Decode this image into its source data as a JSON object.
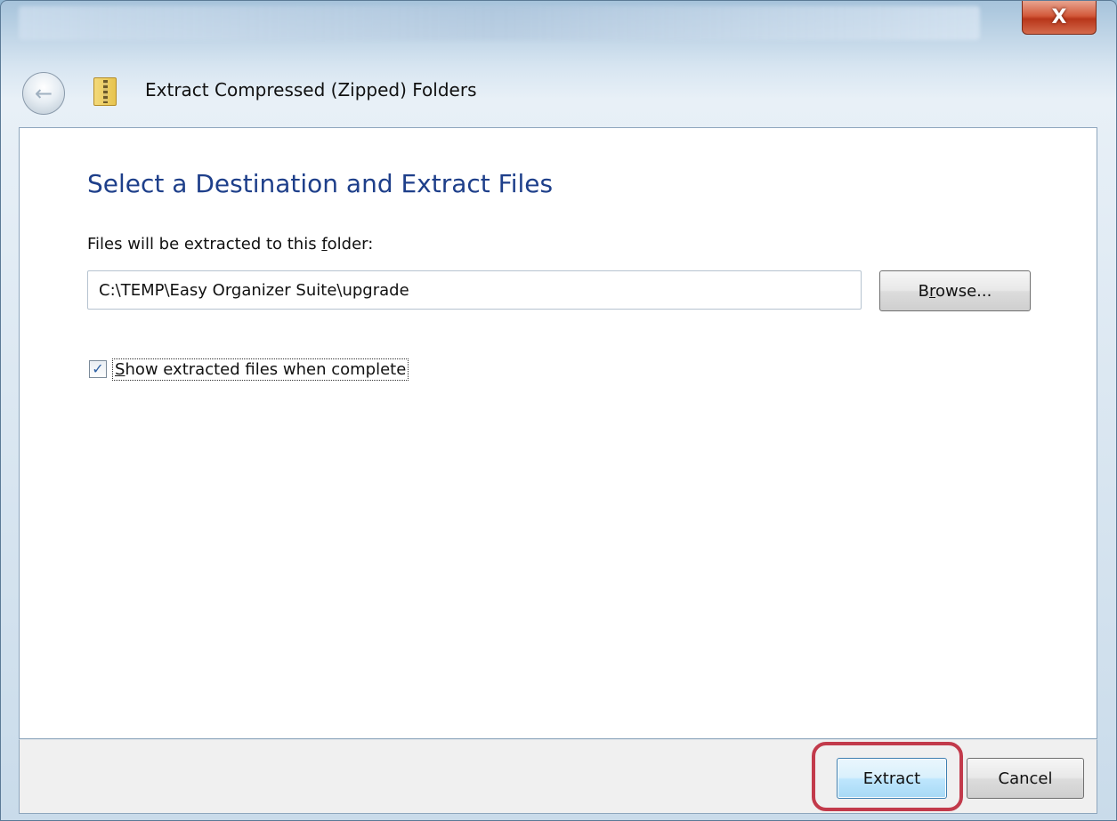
{
  "window": {
    "close_glyph": "X"
  },
  "header": {
    "back_glyph": "←",
    "icon": "zip-folder-icon",
    "title": "Extract Compressed (Zipped) Folders"
  },
  "main": {
    "heading": "Select a Destination and Extract Files",
    "folder_label_pre": "Files will be extracted to this ",
    "folder_label_accel": "f",
    "folder_label_post": "older:",
    "path_value": "C:\\TEMP\\Easy Organizer Suite\\upgrade",
    "browse_pre": "B",
    "browse_accel": "r",
    "browse_post": "owse...",
    "checkbox_checked": true,
    "checkbox_mark": "✓",
    "checkbox_accel": "S",
    "checkbox_label_post": "how extracted files when complete"
  },
  "footer": {
    "extract_label": "Extract",
    "cancel_label": "Cancel",
    "highlight_color": "#c23a4b"
  }
}
